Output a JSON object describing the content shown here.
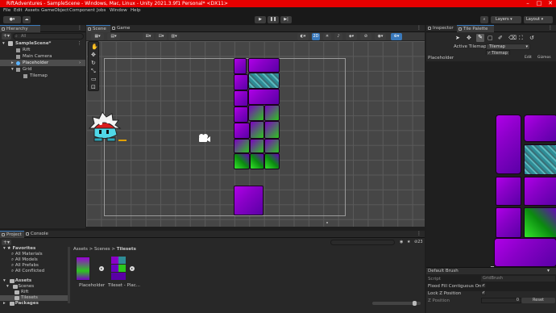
{
  "window": {
    "title": "RiftAdventures - SampleScene - Windows, Mac, Linux - Unity 2021.3.9f1 Personal* <DX11>"
  },
  "menu": [
    "File",
    "Edit",
    "Assets",
    "GameObject",
    "Component",
    "Jobs",
    "Window",
    "Help"
  ],
  "toolbar": {
    "layers_label": "Layers",
    "layout_label": "Layout"
  },
  "hierarchy": {
    "tab_label": "Hierarchy",
    "search_placeholder": "All",
    "items": [
      {
        "label": "SampleScene*"
      },
      {
        "label": "Rift"
      },
      {
        "label": "Main Camera"
      },
      {
        "label": "Placeholder"
      },
      {
        "label": "Grid"
      },
      {
        "label": "Tilemap"
      }
    ]
  },
  "scene": {
    "tabs": [
      "Scene",
      "Game"
    ],
    "mode_2d": "2D"
  },
  "inspector": {
    "tabs": [
      "Inspector",
      "Tile Palette"
    ],
    "active_tilemap_label": "Active Tilemap",
    "active_tilemap_value": "Tilemap",
    "dropdown_option": "Tilemap",
    "palette_dropdown": "Placeholder",
    "edit_label": "Edit",
    "gizmos_label": "Gizmos",
    "default_brush": "Default Brush",
    "script_label": "Script",
    "script_value": "GridBrush",
    "flood_fill_label": "Flood Fill Contiguous Only",
    "lock_z_label": "Lock Z Position",
    "z_position_label": "Z Position",
    "z_position_value": "0",
    "reset_label": "Reset",
    "colors": {
      "accent": "#3a79bb"
    }
  },
  "project": {
    "tabs": [
      "Project",
      "Console"
    ],
    "favorites_label": "Favorites",
    "favorites": [
      "All Materials",
      "All Models",
      "All Prefabs",
      "All Conflicted"
    ],
    "assets_label": "Assets",
    "assets_tree": [
      "Scenes",
      "Rift",
      "Tilesets"
    ],
    "packages_label": "Packages",
    "breadcrumb": [
      "Assets",
      "Scenes",
      "Tilesets"
    ],
    "visible_count": "23",
    "files": [
      {
        "label": "Placeholder"
      },
      {
        "label": "Tileset - Plac..."
      }
    ]
  }
}
